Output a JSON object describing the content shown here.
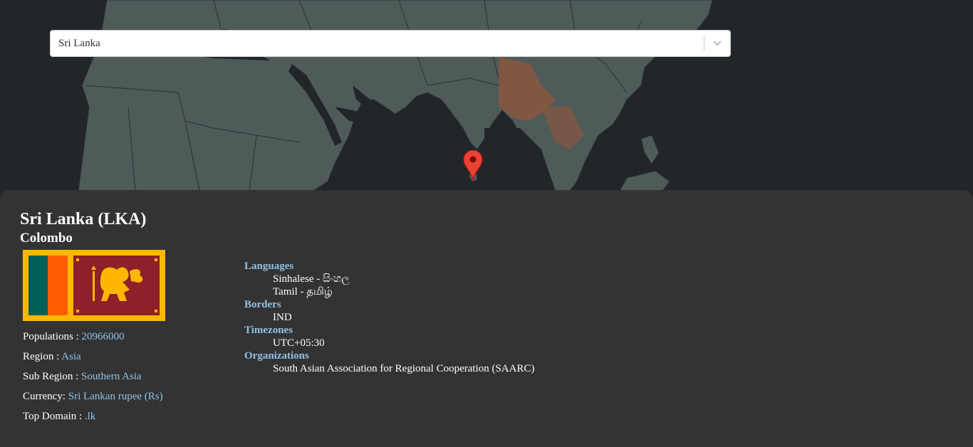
{
  "search": {
    "value": "Sri Lanka"
  },
  "colors": {
    "background": "#232629",
    "land": "#4f5b59",
    "panel": "#333333",
    "accent": "#8ec2e6",
    "marker": "#ea4335"
  },
  "map": {
    "marker_icon": "map-pin-icon"
  },
  "country": {
    "title": "Sri Lanka (LKA)",
    "capital": "Colombo",
    "flag_icon": "sri-lanka-flag-icon",
    "facts": [
      {
        "label": "Populations : ",
        "value": "20966000"
      },
      {
        "label": "Region : ",
        "value": "Asia"
      },
      {
        "label": "Sub Region : ",
        "value": "Southern Asia"
      },
      {
        "label": "Currency: ",
        "value": "Sri Lankan rupee (Rs)"
      },
      {
        "label": "Top Domain : ",
        "value": ".lk"
      }
    ],
    "languages": {
      "heading": "Languages",
      "items": [
        "Sinhalese - සිංහල",
        "Tamil - தமிழ்"
      ]
    },
    "borders": {
      "heading": "Borders",
      "items": [
        "IND"
      ]
    },
    "timezones": {
      "heading": "Timezones",
      "items": [
        "UTC+05:30"
      ]
    },
    "organizations": {
      "heading": "Organizations",
      "items": [
        "South Asian Association for Regional Cooperation (SAARC)"
      ]
    }
  }
}
